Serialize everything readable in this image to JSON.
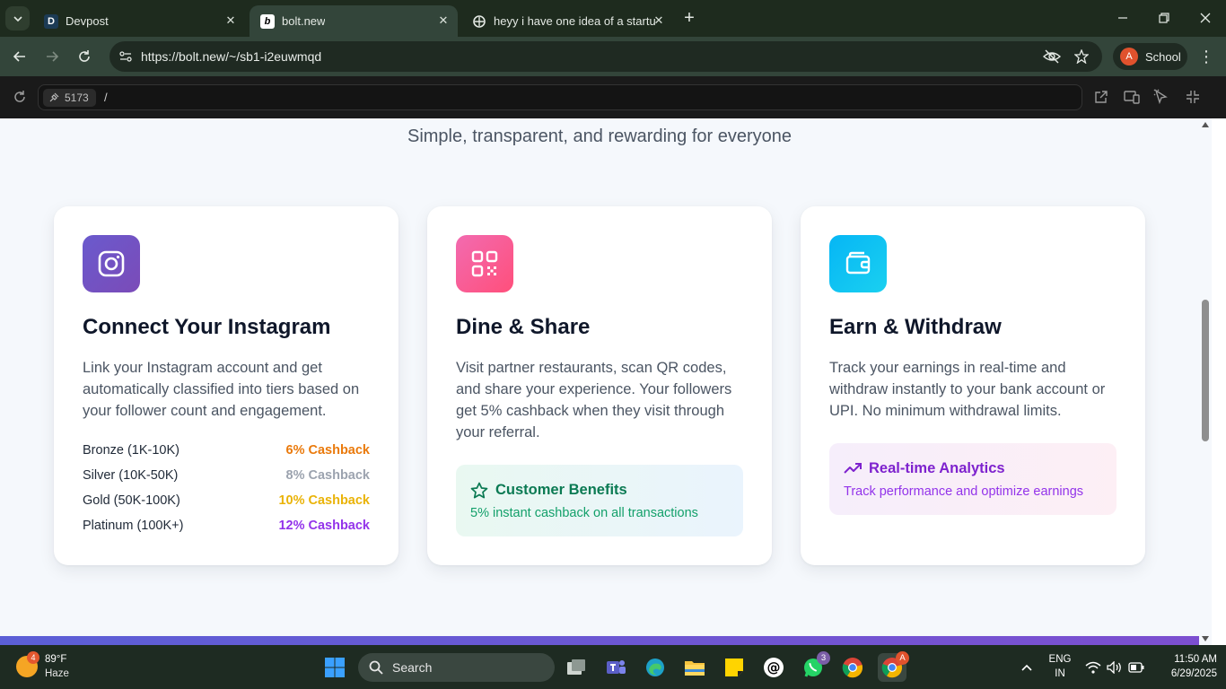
{
  "browser": {
    "tabs": [
      {
        "title": "Devpost",
        "favicon": "D",
        "active": false
      },
      {
        "title": "bolt.new",
        "favicon": "b",
        "active": true
      },
      {
        "title": "heyy i have one idea of a startup",
        "favicon": "ai-logo",
        "active": false
      }
    ],
    "url": "https://bolt.new/~/sb1-i2euwmqd",
    "profile_initial": "A",
    "profile_label": "School"
  },
  "preview": {
    "port": "5173",
    "path": "/"
  },
  "page": {
    "subtitle": "Simple, transparent, and rewarding for everyone",
    "cards": [
      {
        "icon": "instagram-icon",
        "title": "Connect Your Instagram",
        "description": "Link your Instagram account and get automatically classified into tiers based on your follower count and engagement.",
        "tiers": [
          {
            "name": "Bronze (1K-10K)",
            "cashback": "6% Cashback",
            "color": "#ea7a0c"
          },
          {
            "name": "Silver (10K-50K)",
            "cashback": "8% Cashback",
            "color": "#9ca3af"
          },
          {
            "name": "Gold (50K-100K)",
            "cashback": "10% Cashback",
            "color": "#eab308"
          },
          {
            "name": "Platinum (100K+)",
            "cashback": "12% Cashback",
            "color": "#9333ea"
          }
        ]
      },
      {
        "icon": "qr-code-icon",
        "title": "Dine & Share",
        "description": "Visit partner restaurants, scan QR codes, and share your experience. Your followers get 5% cashback when they visit through your referral.",
        "benefit_title": "Customer Benefits",
        "benefit_text": "5% instant cashback on all transactions"
      },
      {
        "icon": "wallet-icon",
        "title": "Earn & Withdraw",
        "description": "Track your earnings in real-time and withdraw instantly to your bank account or UPI. No minimum withdrawal limits.",
        "analytics_title": "Real-time Analytics",
        "analytics_text": "Track performance and optimize earnings"
      }
    ]
  },
  "taskbar": {
    "weather_badge": "4",
    "temperature": "89°F",
    "condition": "Haze",
    "search_label": "Search",
    "whatsapp_badge": "3",
    "chrome_badge": "A",
    "lang_top": "ENG",
    "lang_bottom": "IN",
    "time": "11:50 AM",
    "date": "6/29/2025"
  }
}
